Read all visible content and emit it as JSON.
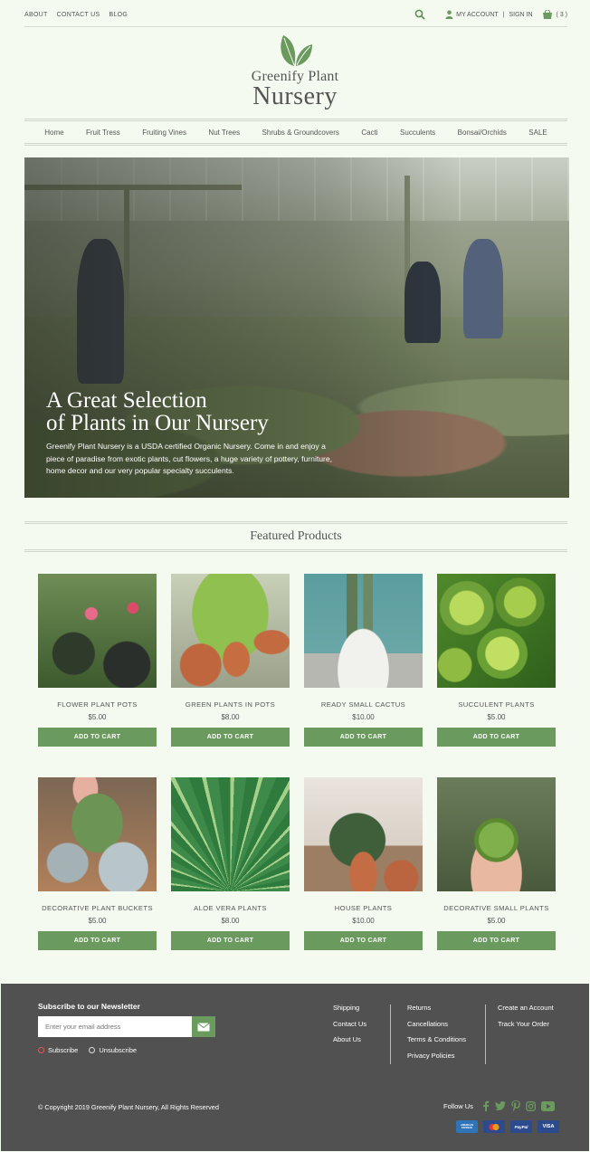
{
  "topbar": {
    "links": [
      "ABOUT",
      "CONTACT US",
      "BLOG"
    ],
    "my_account": "MY ACCOUNT",
    "separator": "|",
    "sign_in": "SIGN IN",
    "cart_count": "( 3 )"
  },
  "logo": {
    "line1": "Greenify Plant",
    "line2": "Nursery"
  },
  "nav": [
    "Home",
    "Fruit Tress",
    "Fruiting Vines",
    "Nut Trees",
    "Shrubs & Groundcovers",
    "Cacti",
    "Succulents",
    "Bonsai/Orchids",
    "SALE"
  ],
  "hero": {
    "title_line1": "A Great Selection",
    "title_line2": "of Plants in Our Nursery",
    "text": "Greenify Plant Nursery is a USDA certified Organic Nursery. Come in and enjoy a piece of paradise from exotic plants, cut flowers, a huge variety of pottery, furniture, home decor and our very popular specialty succulents."
  },
  "featured": {
    "heading": "Featured Products",
    "add_to_cart": "ADD TO CART",
    "products": [
      {
        "name": "FLOWER PLANT POTS",
        "price": "$5.00"
      },
      {
        "name": "GREEN PLANTS IN POTS",
        "price": "$8.00"
      },
      {
        "name": "READY SMALL CACTUS",
        "price": "$10.00"
      },
      {
        "name": "SUCCULENT PLANTS",
        "price": "$5.00"
      },
      {
        "name": "DECORATIVE PLANT BUCKETS",
        "price": "$5.00"
      },
      {
        "name": "ALOE VERA PLANTS",
        "price": "$8.00"
      },
      {
        "name": "HOUSE PLANTS",
        "price": "$10.00"
      },
      {
        "name": "DECORATIVE SMALL PLANTS",
        "price": "$5.00"
      }
    ]
  },
  "footer": {
    "newsletter_title": "Subscribe to our Newsletter",
    "email_placeholder": "Enter your email address",
    "subscribe": "Subscribe",
    "unsubscribe": "Unsubscribe",
    "col1": [
      "Shipping",
      "Contact Us",
      "About Us"
    ],
    "col2": [
      "Returns",
      "Cancellations",
      "Terms & Conditions",
      "Privacy Policies"
    ],
    "col3": [
      "Create an Account",
      "Track Your Order"
    ],
    "copyright": "© Copyright 2019 Greenify Plant Nursery, All Rights Reserved",
    "follow_us": "Follow Us",
    "payments": [
      "AMERICAN EXPRESS",
      "mastercard",
      "PayPal",
      "VISA"
    ]
  },
  "colors": {
    "accent": "#6b9a5f",
    "footer_bg": "#515151",
    "page_bg": "#f4faf0"
  }
}
